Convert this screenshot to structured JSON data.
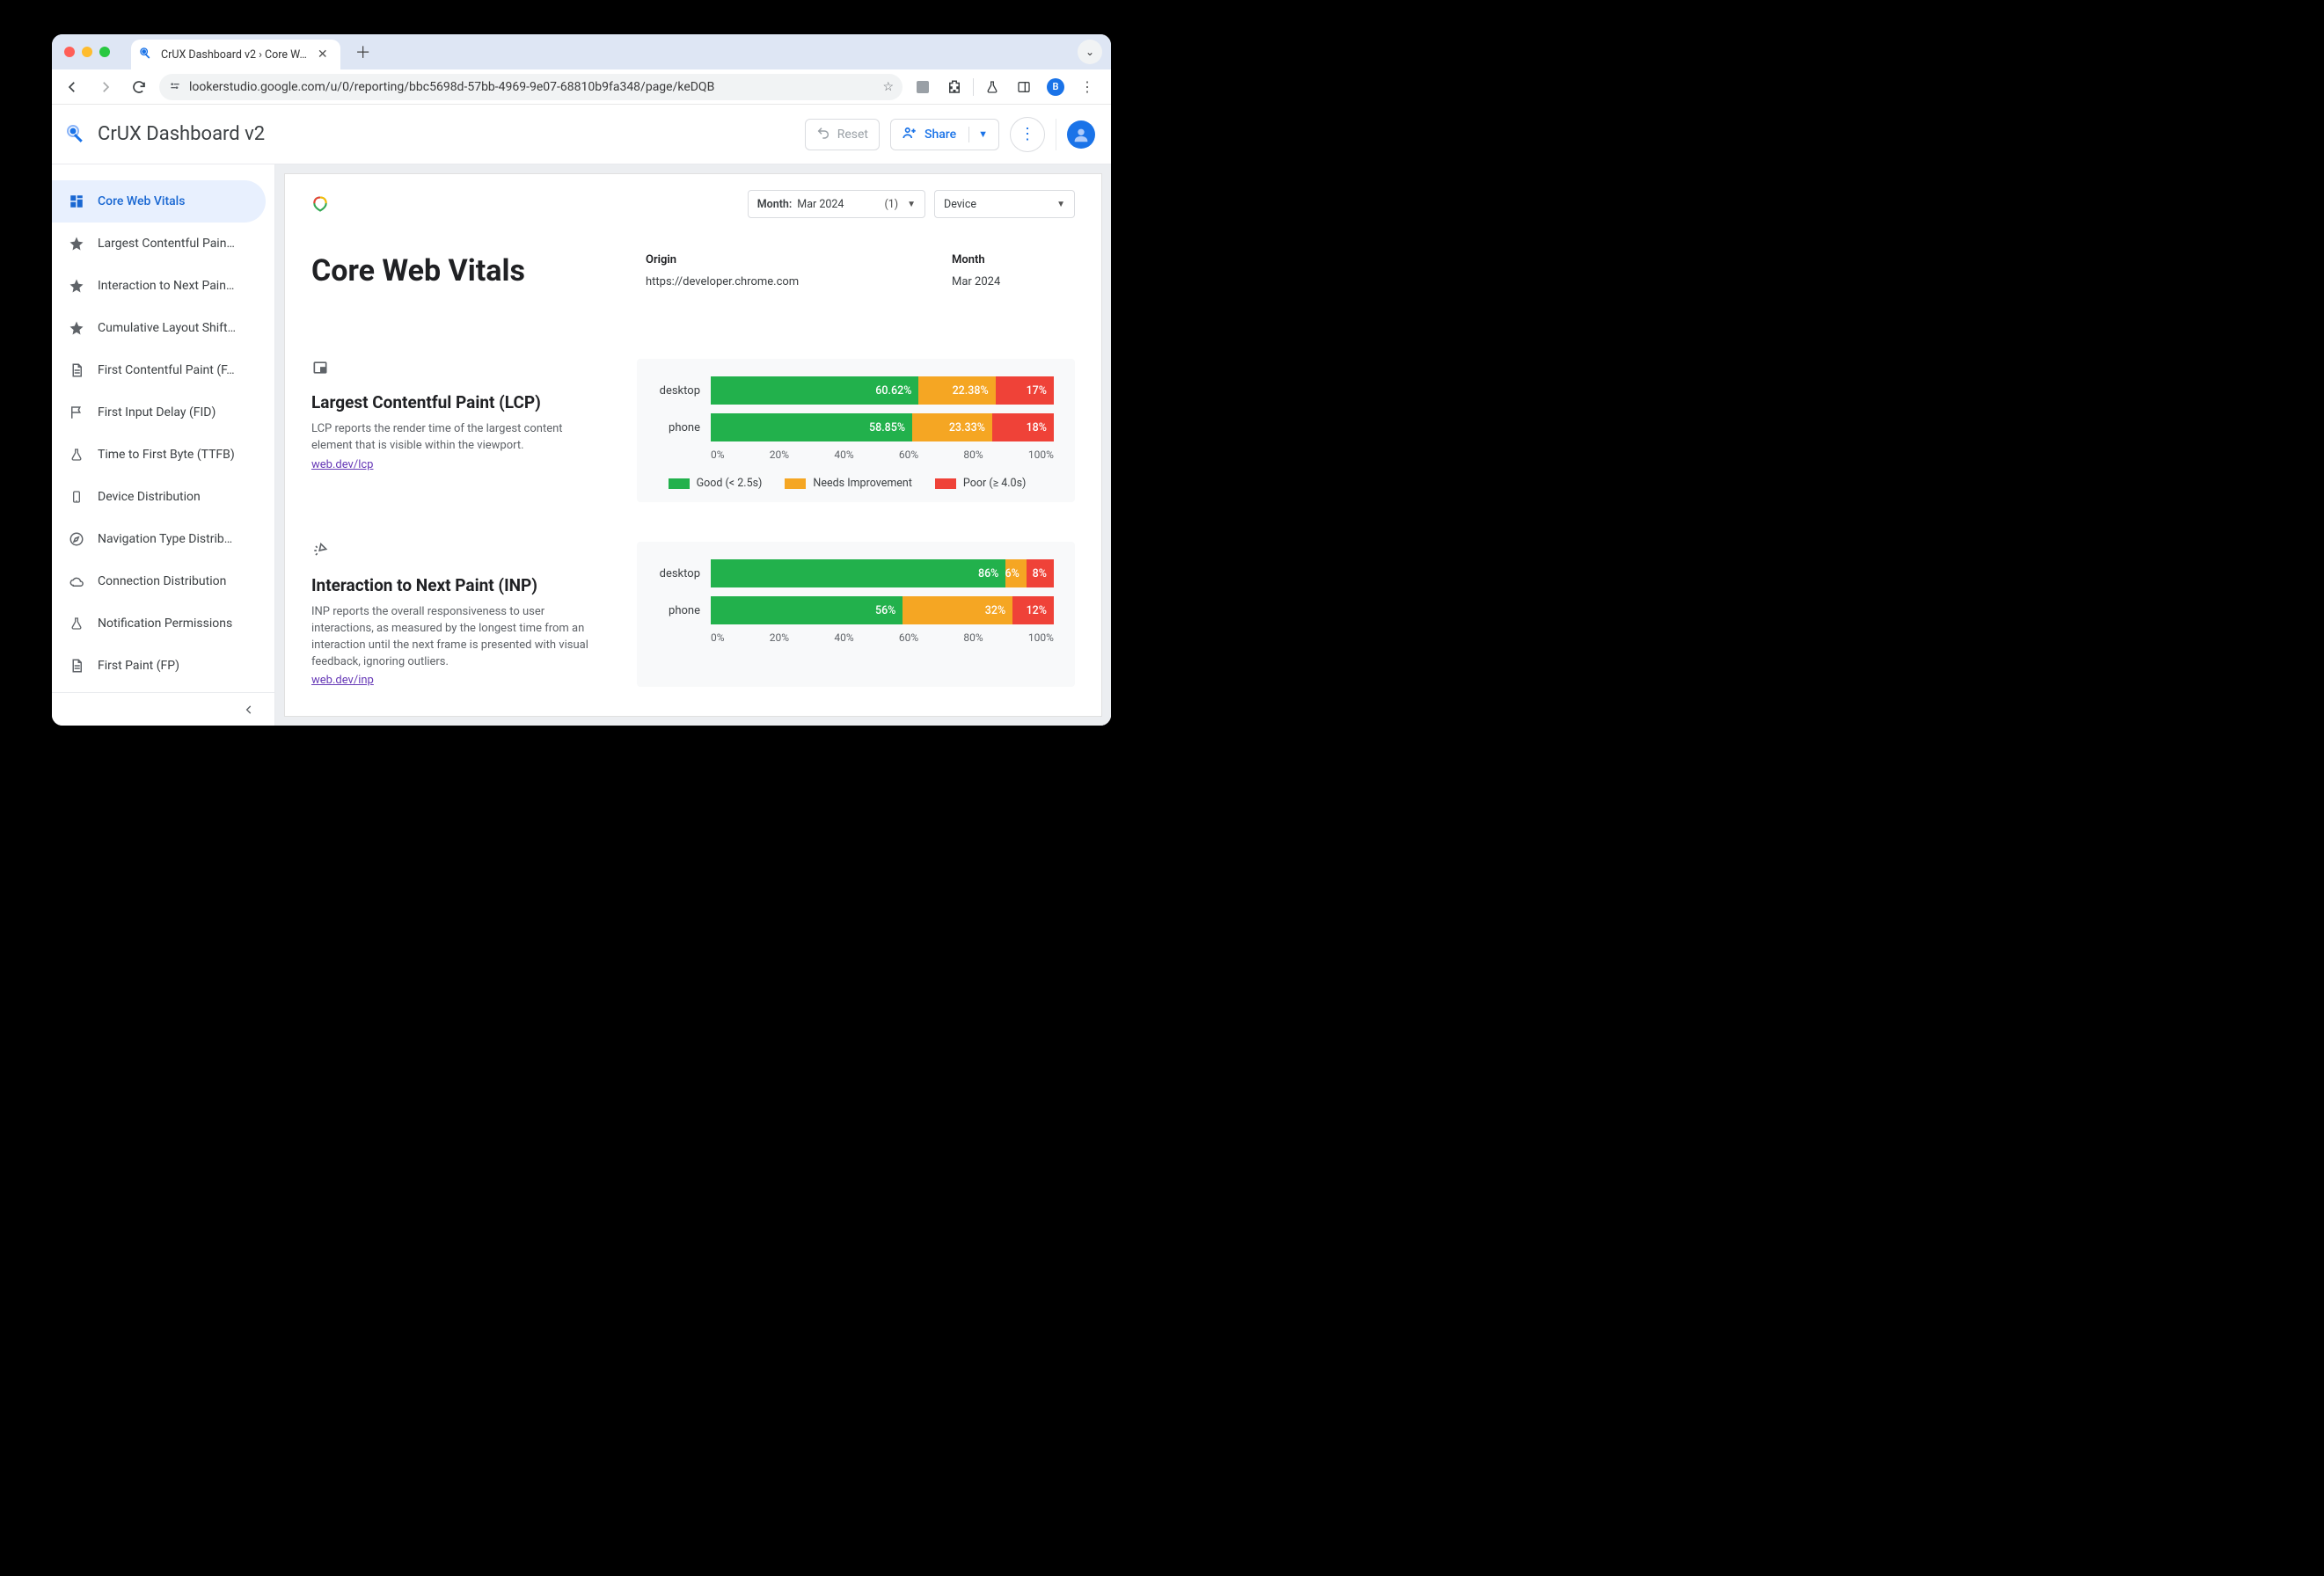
{
  "tab": {
    "title": "CrUX Dashboard v2 › Core W…"
  },
  "url": "lookerstudio.google.com/u/0/reporting/bbc5698d-57bb-4969-9e07-68810b9fa348/page/keDQB",
  "app_title": "CrUX Dashboard v2",
  "header": {
    "reset": "Reset",
    "share": "Share"
  },
  "sidebar": {
    "items": [
      {
        "label": "Core Web Vitals",
        "icon": "dashboard"
      },
      {
        "label": "Largest Contentful Pain…",
        "icon": "star"
      },
      {
        "label": "Interaction to Next Pain…",
        "icon": "star"
      },
      {
        "label": "Cumulative Layout Shift…",
        "icon": "star"
      },
      {
        "label": "First Contentful Paint (F…",
        "icon": "doc"
      },
      {
        "label": "First Input Delay (FID)",
        "icon": "flag"
      },
      {
        "label": "Time to First Byte (TTFB)",
        "icon": "flask"
      },
      {
        "label": "Device Distribution",
        "icon": "phone"
      },
      {
        "label": "Navigation Type Distrib…",
        "icon": "compass"
      },
      {
        "label": "Connection Distribution",
        "icon": "cloud"
      },
      {
        "label": "Notification Permissions",
        "icon": "flask"
      },
      {
        "label": "First Paint (FP)",
        "icon": "doc"
      }
    ]
  },
  "filters": {
    "month_label": "Month:",
    "month_value": "Mar 2024",
    "month_count": "(1)",
    "device_label": "Device"
  },
  "page": {
    "title": "Core Web Vitals",
    "origin_label": "Origin",
    "origin_value": "https://developer.chrome.com",
    "month_label": "Month",
    "month_value": "Mar 2024"
  },
  "axis_ticks": [
    "0%",
    "20%",
    "40%",
    "60%",
    "80%",
    "100%"
  ],
  "legend": {
    "lcp": {
      "good": "Good (< 2.5s)",
      "ni": "Needs Improvement",
      "poor": "Poor (≥ 4.0s)"
    }
  },
  "metrics": [
    {
      "key": "lcp",
      "title": "Largest Contentful Paint (LCP)",
      "desc": "LCP reports the render time of the largest content element that is visible within the viewport.",
      "link": "web.dev/lcp"
    },
    {
      "key": "inp",
      "title": "Interaction to Next Paint (INP)",
      "desc": "INP reports the overall responsiveness to user interactions, as measured by the longest time from an interaction until the next frame is presented with visual feedback, ignoring outliers.",
      "link": "web.dev/inp"
    }
  ],
  "chart_data": [
    {
      "type": "bar",
      "metric": "LCP",
      "orientation": "horizontal-stacked",
      "categories": [
        "desktop",
        "phone"
      ],
      "series": [
        {
          "name": "Good (< 2.5s)",
          "values": [
            60.62,
            58.85
          ],
          "color": "#22b14c"
        },
        {
          "name": "Needs Improvement",
          "values": [
            22.38,
            23.33
          ],
          "color": "#f5a623"
        },
        {
          "name": "Poor (≥ 4.0s)",
          "values": [
            17,
            18
          ],
          "color": "#ef4238"
        }
      ],
      "xlabel": "",
      "ylabel": "",
      "xlim": [
        0,
        100
      ],
      "unit": "%"
    },
    {
      "type": "bar",
      "metric": "INP",
      "orientation": "horizontal-stacked",
      "categories": [
        "desktop",
        "phone"
      ],
      "series": [
        {
          "name": "Good",
          "values": [
            86,
            56
          ],
          "color": "#22b14c"
        },
        {
          "name": "Needs Improvement",
          "values": [
            6,
            32
          ],
          "color": "#f5a623"
        },
        {
          "name": "Poor",
          "values": [
            8,
            12
          ],
          "color": "#ef4238"
        }
      ],
      "xlabel": "",
      "ylabel": "",
      "xlim": [
        0,
        100
      ],
      "unit": "%"
    }
  ],
  "avatar_letter": "B"
}
